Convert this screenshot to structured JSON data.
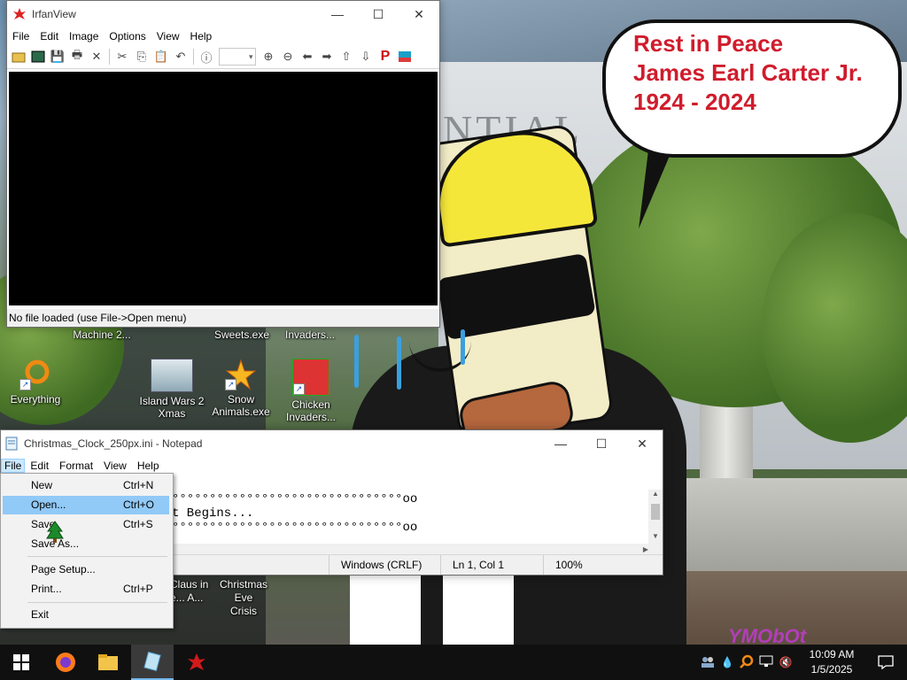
{
  "wallpaper": {
    "building_text": "NTIAL",
    "speech_bubble": {
      "line1": "Rest in Peace",
      "line2": "James Earl Carter Jr.",
      "line3": "1924 - 2024"
    },
    "watermark": "YMObOt"
  },
  "desktop_icons": [
    {
      "label": "Machine 2...",
      "icon": "app-icon"
    },
    {
      "label": "Sweets.exe",
      "icon": "app-icon"
    },
    {
      "label": "Invaders...",
      "icon": "app-icon"
    },
    {
      "label": "Everything",
      "icon": "everything-search-icon"
    },
    {
      "label": "Island Wars 2 Xmas",
      "icon": "island-wars-icon"
    },
    {
      "label": "Snow Animals.exe",
      "icon": "snow-animals-icon"
    },
    {
      "label": "Chicken Invaders...",
      "icon": "chicken-invaders-icon"
    }
  ],
  "desktop_captions_under_menu": [
    {
      "line1": "Claus in",
      "line2": "e... A..."
    },
    {
      "line1": "Christmas Eve",
      "line2": "Crisis"
    }
  ],
  "irfanview": {
    "title": "IrfanView",
    "menu": [
      "File",
      "Edit",
      "Image",
      "Options",
      "View",
      "Help"
    ],
    "status": "No file loaded (use File->Open menu)"
  },
  "notepad": {
    "title": "Christmas_Clock_250px.ini - Notepad",
    "menu": [
      "File",
      "Edit",
      "Format",
      "View",
      "Help"
    ],
    "lines": [
      "°°°°°°°°°°°°°°°°°°°°°°°°°°°°°°°oo",
      "t Begins...",
      "°°°°°°°°°°°°°°°°°°°°°°°°°°°°°°°oo"
    ],
    "status": {
      "line_endings": "Windows (CRLF)",
      "position": "Ln 1, Col 1",
      "zoom": "100%"
    }
  },
  "file_menu": {
    "items": [
      {
        "label": "New",
        "shortcut": "Ctrl+N"
      },
      {
        "label": "Open...",
        "shortcut": "Ctrl+O"
      },
      {
        "label": "Save",
        "shortcut": "Ctrl+S"
      },
      {
        "label": "Save As...",
        "shortcut": ""
      },
      {
        "label": "Page Setup...",
        "shortcut": ""
      },
      {
        "label": "Print...",
        "shortcut": "Ctrl+P"
      },
      {
        "label": "Exit",
        "shortcut": ""
      }
    ],
    "highlighted": "Open..."
  },
  "taskbar": {
    "clock_time": "10:09 AM",
    "clock_date": "1/5/2025"
  },
  "colors": {
    "bubble_text": "#d01c2c",
    "menu_highlight": "#91c9f7",
    "taskbar": "#101010"
  }
}
